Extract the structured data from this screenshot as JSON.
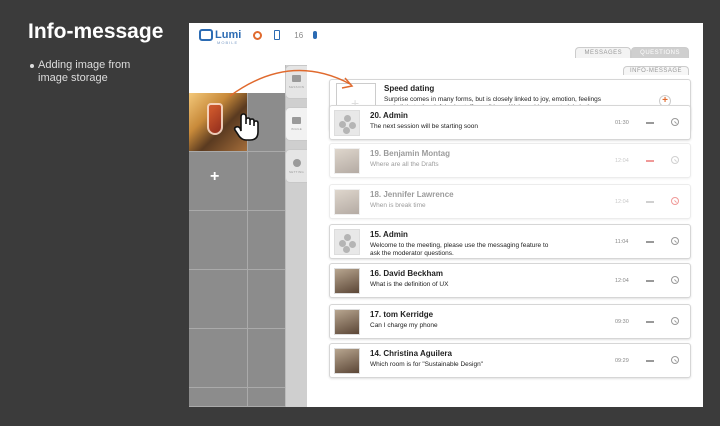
{
  "slide": {
    "title": "Info-message",
    "bullet": "Adding image from image storage"
  },
  "app": {
    "logo": "Lumi",
    "logo_sub": "MOBILE",
    "count": "16",
    "tabs": [
      "MESSAGES",
      "QUESTIONS"
    ],
    "subtab": "INFO-MESSAGE"
  },
  "sidebar_tabs": [
    "SESSION",
    "IMAGE",
    "SETTING"
  ],
  "grid": {
    "add_label": "+"
  },
  "info_message": {
    "title": "Speed dating",
    "text": "Surprise comes in many forms, but is closely linked to joy, emotion, feelings and all that other left brain stuff we all love. We're asking you to join in the fun by coming ready to surprise and be surprised!",
    "add": "+"
  },
  "messages": [
    {
      "name": "20. Admin",
      "text": "The next session will be starting soon",
      "time": "01:30",
      "faded": false,
      "avatar": "logo",
      "dash_red": false,
      "block_red": false
    },
    {
      "name": "19. Benjamin Montag",
      "text": "Where are all the Drafts",
      "time": "12:04",
      "faded": true,
      "avatar": "photo",
      "dash_red": true,
      "block_red": false
    },
    {
      "name": "18. Jennifer Lawrence",
      "text": "When is break time",
      "time": "12:04",
      "faded": true,
      "avatar": "photo",
      "dash_red": false,
      "block_red": true
    },
    {
      "name": "15. Admin",
      "text": "Welcome to the meeting, please use the messaging feature to ask the moderator questions.",
      "time": "11:04",
      "faded": false,
      "avatar": "logo",
      "dash_red": false,
      "block_red": false
    },
    {
      "name": "16. David Beckham",
      "text": "What is the definition of UX",
      "time": "12:04",
      "faded": false,
      "avatar": "photo",
      "dash_red": false,
      "block_red": false
    },
    {
      "name": "17. tom Kerridge",
      "text": "Can I charge my phone",
      "time": "09:30",
      "faded": false,
      "avatar": "photo",
      "dash_red": false,
      "block_red": false
    },
    {
      "name": "14. Christina Aguilera",
      "text": "Which room is for \"Sustainable Design\"",
      "time": "09:29",
      "faded": false,
      "avatar": "photo",
      "dash_red": false,
      "block_red": false
    }
  ],
  "colors": {
    "accent": "#e06a2e",
    "brand": "#2b6bb3",
    "danger": "#e0201c"
  }
}
